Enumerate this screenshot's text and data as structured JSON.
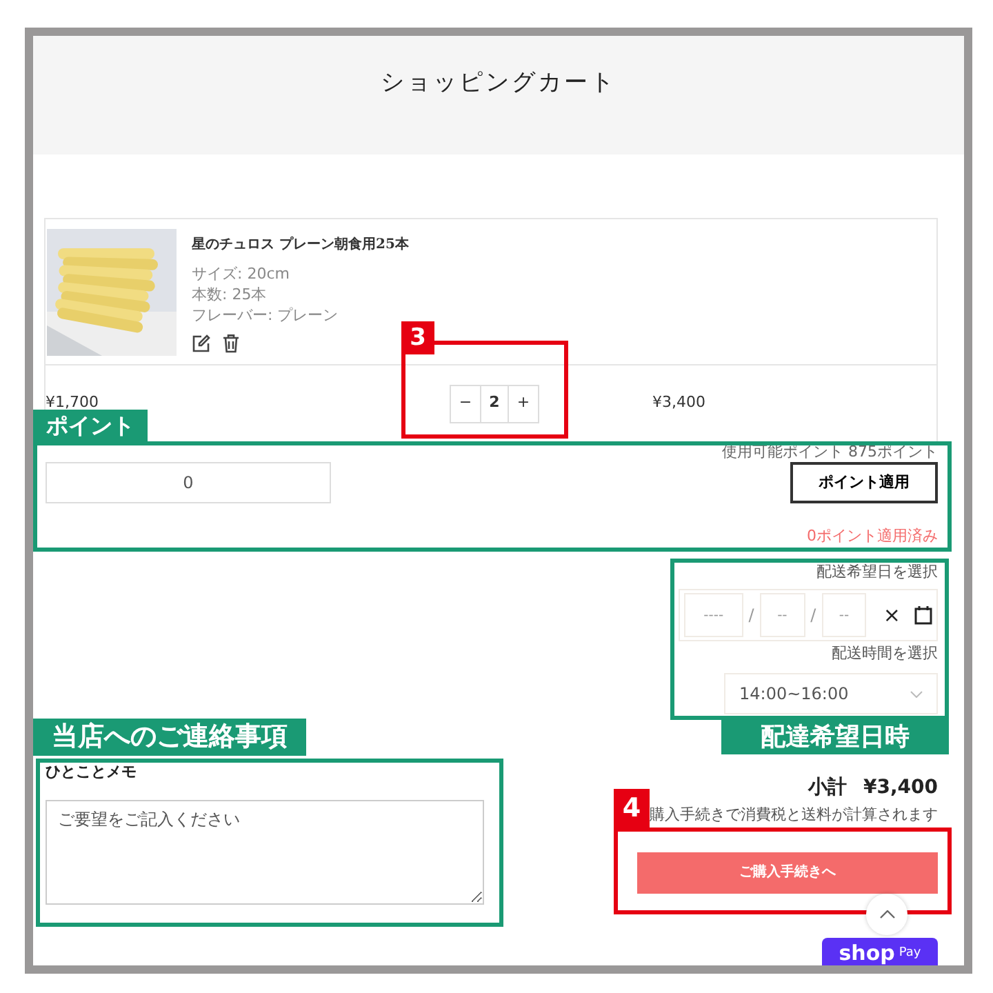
{
  "header": {
    "title": "ショッピングカート"
  },
  "cart_item": {
    "name": "星のチュロス プレーン朝食用25本",
    "options": [
      "サイズ: 20cm",
      "本数: 25本",
      "フレーバー: プレーン"
    ],
    "unit_price": "¥1,700",
    "minus": "−",
    "quantity": "2",
    "plus": "+",
    "line_total": "¥3,400"
  },
  "points": {
    "available": "使用可能ポイント 875ポイント",
    "value": "0",
    "apply_button": "ポイント適用",
    "applied": "0ポイント適用済み"
  },
  "delivery": {
    "date_label": "配送希望日を選択",
    "date_placeholders": [
      "----",
      "--",
      "--"
    ],
    "separators": [
      "/",
      "/"
    ],
    "clear": "×",
    "time_label": "配送時間を選択",
    "time_value": "14:00~16:00"
  },
  "memo": {
    "label": "ひとことメモ",
    "placeholder": "ご要望をご記入ください"
  },
  "summary": {
    "subtotal_label": "小計",
    "subtotal": "¥3,400",
    "note": "購入手続きで消費税と送料が計算されます",
    "checkout_button": "ご購入手続きへ"
  },
  "shop_pay": {
    "shop": "shop",
    "pay": "Pay"
  },
  "annotations": [
    {
      "kind": "numbered",
      "text": "3"
    },
    {
      "kind": "section",
      "text": "ポイント"
    },
    {
      "kind": "section",
      "text": "当店へのご連絡事項"
    },
    {
      "kind": "section",
      "text": "配達希望日時"
    },
    {
      "kind": "numbered",
      "text": "4"
    }
  ]
}
